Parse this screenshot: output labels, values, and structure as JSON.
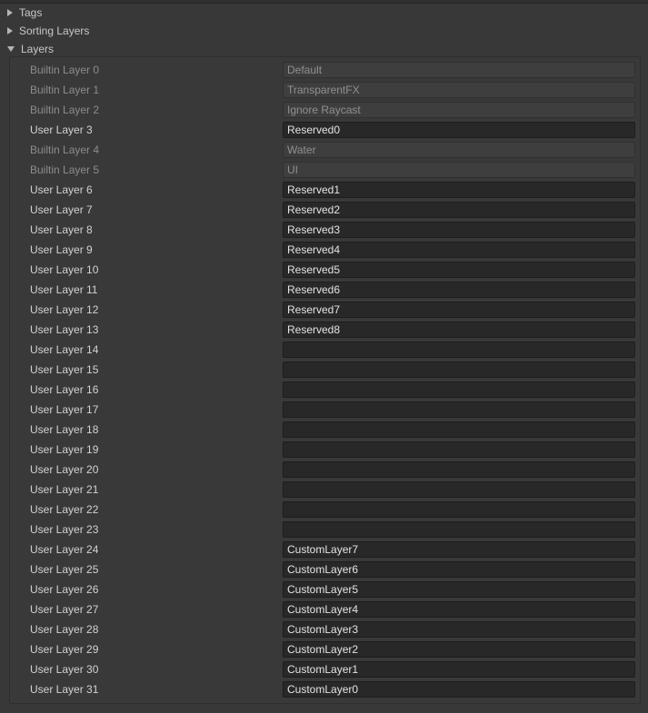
{
  "panel": {
    "sections": [
      {
        "label": "Tags",
        "expanded": false,
        "icon": "chevron-right-icon"
      },
      {
        "label": "Sorting Layers",
        "expanded": false,
        "icon": "chevron-right-icon"
      },
      {
        "label": "Layers",
        "expanded": true,
        "icon": "chevron-down-icon"
      }
    ]
  },
  "colors": {
    "background": "#383838",
    "box_background": "#393939",
    "field_editable_bg": "#282828",
    "field_readonly_bg": "#3e3e3e",
    "text_primary": "#d2d2d2",
    "text_disabled": "#8c8c8c",
    "border": "#2e2e2e"
  },
  "layers": [
    {
      "label": "Builtin Layer 0",
      "value": "Default",
      "editable": false
    },
    {
      "label": "Builtin Layer 1",
      "value": "TransparentFX",
      "editable": false
    },
    {
      "label": "Builtin Layer 2",
      "value": "Ignore Raycast",
      "editable": false
    },
    {
      "label": "User Layer 3",
      "value": "Reserved0",
      "editable": true
    },
    {
      "label": "Builtin Layer 4",
      "value": "Water",
      "editable": false
    },
    {
      "label": "Builtin Layer 5",
      "value": "UI",
      "editable": false
    },
    {
      "label": "User Layer 6",
      "value": "Reserved1",
      "editable": true
    },
    {
      "label": "User Layer 7",
      "value": "Reserved2",
      "editable": true
    },
    {
      "label": "User Layer 8",
      "value": "Reserved3",
      "editable": true
    },
    {
      "label": "User Layer 9",
      "value": "Reserved4",
      "editable": true
    },
    {
      "label": "User Layer 10",
      "value": "Reserved5",
      "editable": true
    },
    {
      "label": "User Layer 11",
      "value": "Reserved6",
      "editable": true
    },
    {
      "label": "User Layer 12",
      "value": "Reserved7",
      "editable": true
    },
    {
      "label": "User Layer 13",
      "value": "Reserved8",
      "editable": true
    },
    {
      "label": "User Layer 14",
      "value": "",
      "editable": true
    },
    {
      "label": "User Layer 15",
      "value": "",
      "editable": true
    },
    {
      "label": "User Layer 16",
      "value": "",
      "editable": true
    },
    {
      "label": "User Layer 17",
      "value": "",
      "editable": true
    },
    {
      "label": "User Layer 18",
      "value": "",
      "editable": true
    },
    {
      "label": "User Layer 19",
      "value": "",
      "editable": true
    },
    {
      "label": "User Layer 20",
      "value": "",
      "editable": true
    },
    {
      "label": "User Layer 21",
      "value": "",
      "editable": true
    },
    {
      "label": "User Layer 22",
      "value": "",
      "editable": true
    },
    {
      "label": "User Layer 23",
      "value": "",
      "editable": true
    },
    {
      "label": "User Layer 24",
      "value": "CustomLayer7",
      "editable": true
    },
    {
      "label": "User Layer 25",
      "value": "CustomLayer6",
      "editable": true
    },
    {
      "label": "User Layer 26",
      "value": "CustomLayer5",
      "editable": true
    },
    {
      "label": "User Layer 27",
      "value": "CustomLayer4",
      "editable": true
    },
    {
      "label": "User Layer 28",
      "value": "CustomLayer3",
      "editable": true
    },
    {
      "label": "User Layer 29",
      "value": "CustomLayer2",
      "editable": true
    },
    {
      "label": "User Layer 30",
      "value": "CustomLayer1",
      "editable": true
    },
    {
      "label": "User Layer 31",
      "value": "CustomLayer0",
      "editable": true
    }
  ]
}
